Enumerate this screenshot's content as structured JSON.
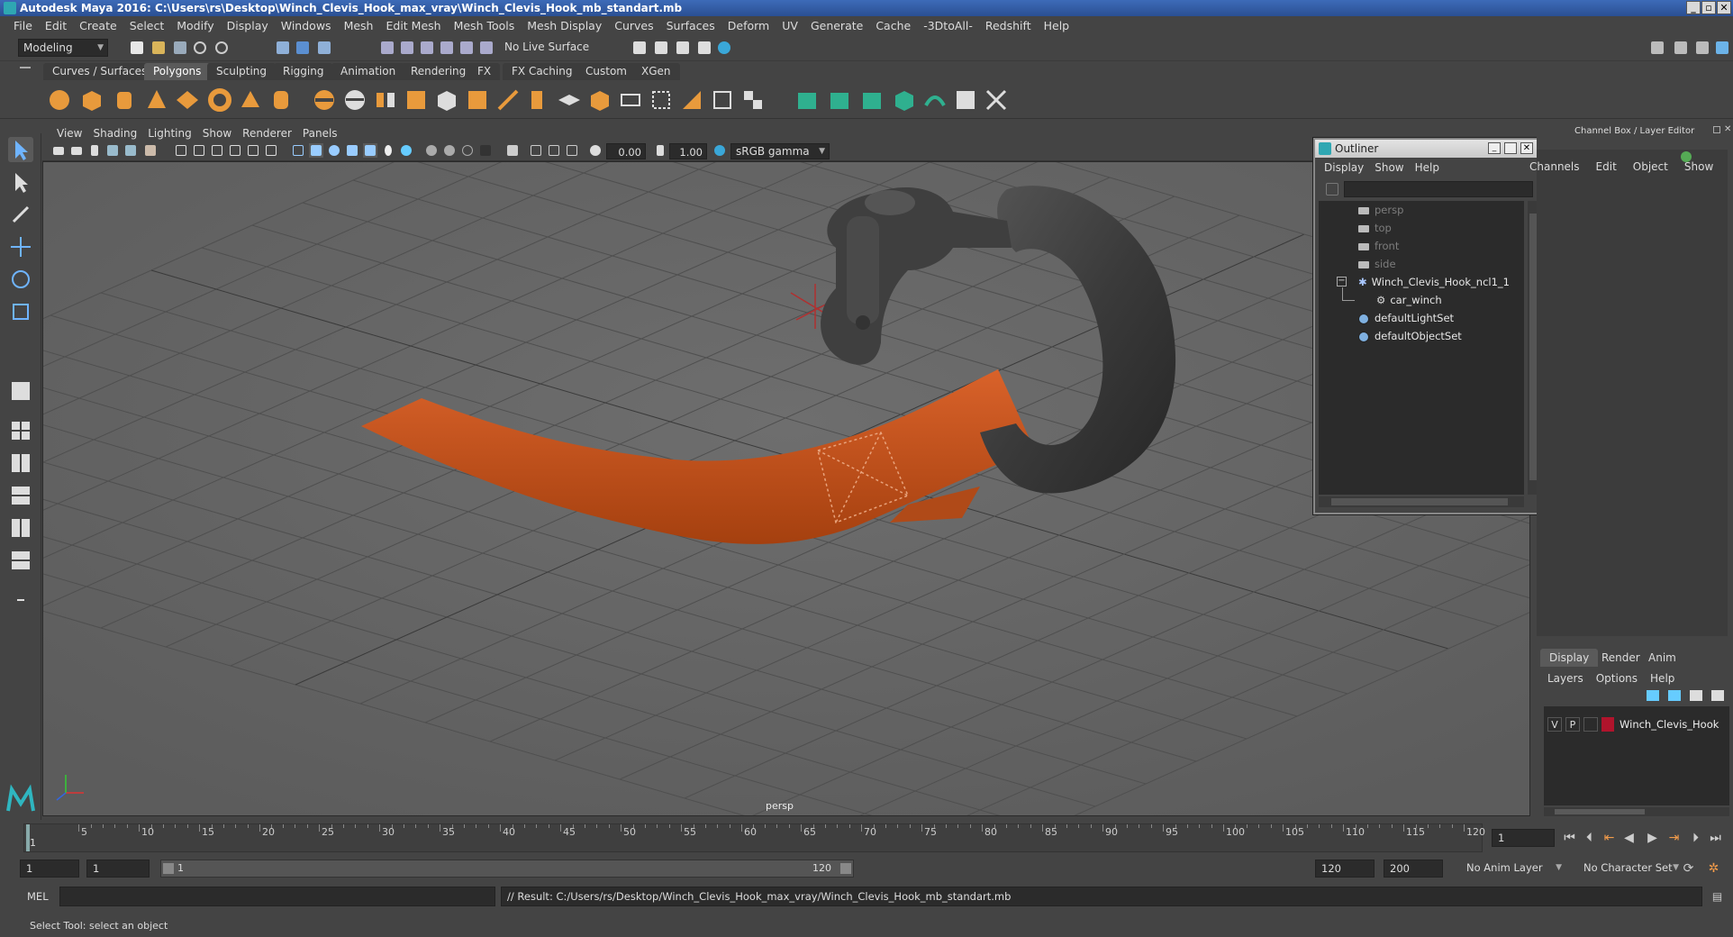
{
  "window": {
    "title": "Autodesk Maya 2016: C:\\Users\\rs\\Desktop\\Winch_Clevis_Hook_max_vray\\Winch_Clevis_Hook_mb_standart.mb"
  },
  "menubar": [
    "File",
    "Edit",
    "Create",
    "Select",
    "Modify",
    "Display",
    "Windows",
    "Mesh",
    "Edit Mesh",
    "Mesh Tools",
    "Mesh Display",
    "Curves",
    "Surfaces",
    "Deform",
    "UV",
    "Generate",
    "Cache",
    "-3DtoAll-",
    "Redshift",
    "Help"
  ],
  "statusline": {
    "mode": "Modeling",
    "live_surface": "No Live Surface"
  },
  "shelf": {
    "tabs": [
      "Curves / Surfaces",
      "Polygons",
      "Sculpting",
      "Rigging",
      "Animation",
      "Rendering",
      "FX",
      "FX Caching",
      "Custom",
      "XGen"
    ],
    "active_tab": "Polygons"
  },
  "viewport": {
    "menu": [
      "View",
      "Shading",
      "Lighting",
      "Show",
      "Renderer",
      "Panels"
    ],
    "field_a": "0.00",
    "field_b": "1.00",
    "color_space": "sRGB gamma",
    "camera_label": "persp"
  },
  "outliner": {
    "title": "Outliner",
    "menu": [
      "Display",
      "Show",
      "Help"
    ],
    "items": [
      {
        "label": "persp",
        "style": "dim",
        "icon": "camera-icon"
      },
      {
        "label": "top",
        "style": "dim",
        "icon": "camera-icon"
      },
      {
        "label": "front",
        "style": "dim",
        "icon": "camera-icon"
      },
      {
        "label": "side",
        "style": "dim",
        "icon": "camera-icon"
      },
      {
        "label": "Winch_Clevis_Hook_ncl1_1",
        "style": "lit",
        "icon": "group-icon"
      },
      {
        "label": "car_winch",
        "style": "lit",
        "icon": "mesh-icon"
      },
      {
        "label": "defaultLightSet",
        "style": "lit",
        "icon": "set-icon"
      },
      {
        "label": "defaultObjectSet",
        "style": "lit",
        "icon": "set-icon"
      }
    ]
  },
  "channelbox": {
    "title": "Channel Box / Layer Editor",
    "menu": [
      "Channels",
      "Edit",
      "Object",
      "Show"
    ]
  },
  "layers": {
    "tabs": [
      "Display",
      "Render",
      "Anim"
    ],
    "active_tab": "Display",
    "menu": [
      "Layers",
      "Options",
      "Help"
    ],
    "rows": [
      {
        "v": "V",
        "p": "P",
        "name": "Winch_Clevis_Hook",
        "color": "#b0142c"
      }
    ]
  },
  "timeline": {
    "ticks": [
      "5",
      "10",
      "15",
      "20",
      "25",
      "30",
      "35",
      "40",
      "45",
      "50",
      "55",
      "60",
      "65",
      "70",
      "75",
      "80",
      "85",
      "90",
      "95",
      "100",
      "105",
      "110",
      "115",
      "120"
    ],
    "start_label": "1",
    "current_frame": "1"
  },
  "range": {
    "start": "1",
    "anim_start": "1",
    "slider_left": "1",
    "slider_right": "120",
    "anim_end": "120",
    "end": "200",
    "anim_layer": "No Anim Layer",
    "character_set": "No Character Set"
  },
  "command": {
    "lang": "MEL",
    "result": "// Result: C:/Users/rs/Desktop/Winch_Clevis_Hook_max_vray/Winch_Clevis_Hook_mb_standart.mb"
  },
  "helpline": "Select Tool: select an object",
  "colors": {
    "strap": "#c4511c",
    "hook": "#3d3d3d",
    "viewport_bg": "#686868",
    "layer_swatch": "#b0142c"
  }
}
